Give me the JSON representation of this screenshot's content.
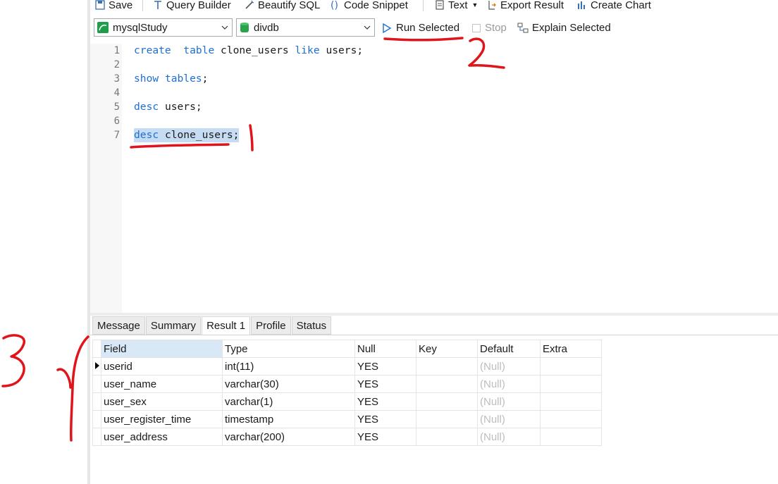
{
  "toolbar": {
    "save": "Save",
    "query_builder": "Query Builder",
    "beautify": "Beautify SQL",
    "snippet": "Code Snippet",
    "text": "Text",
    "export": "Export Result",
    "chart": "Create Chart"
  },
  "connection": {
    "connection_name": "mysqlStudy",
    "database": "divdb",
    "run_selected": "Run Selected",
    "stop": "Stop",
    "explain_selected": "Explain Selected"
  },
  "editor": {
    "lines": [
      "1",
      "2",
      "3",
      "4",
      "5",
      "6",
      "7"
    ],
    "l1_kw1": "create",
    "l1_kw2": "table",
    "l1_t1": "clone_users",
    "l1_kw3": "like",
    "l1_t2": "users;",
    "l3_kw": "show",
    "l3_kw2": "tables",
    "l3_end": ";",
    "l5_kw": "desc",
    "l5_t": "users;",
    "l7_kw": "desc",
    "l7_t": "clone_users;"
  },
  "tabs": [
    "Message",
    "Summary",
    "Result 1",
    "Profile",
    "Status"
  ],
  "result": {
    "columns": [
      "Field",
      "Type",
      "Null",
      "Key",
      "Default",
      "Extra"
    ],
    "rows": [
      [
        "userid",
        "int(11)",
        "YES",
        "",
        "(Null)",
        ""
      ],
      [
        "user_name",
        "varchar(30)",
        "YES",
        "",
        "(Null)",
        ""
      ],
      [
        "user_sex",
        "varchar(1)",
        "YES",
        "",
        "(Null)",
        ""
      ],
      [
        "user_register_time",
        "timestamp",
        "YES",
        "",
        "(Null)",
        ""
      ],
      [
        "user_address",
        "varchar(200)",
        "YES",
        "",
        "(Null)",
        ""
      ]
    ]
  },
  "annotations": {
    "n1": "1",
    "n2": "2",
    "n3": "3"
  },
  "colors": {
    "accent": "#1f6fd1",
    "selection": "#c6dcf2",
    "annotation": "#e0141b"
  }
}
